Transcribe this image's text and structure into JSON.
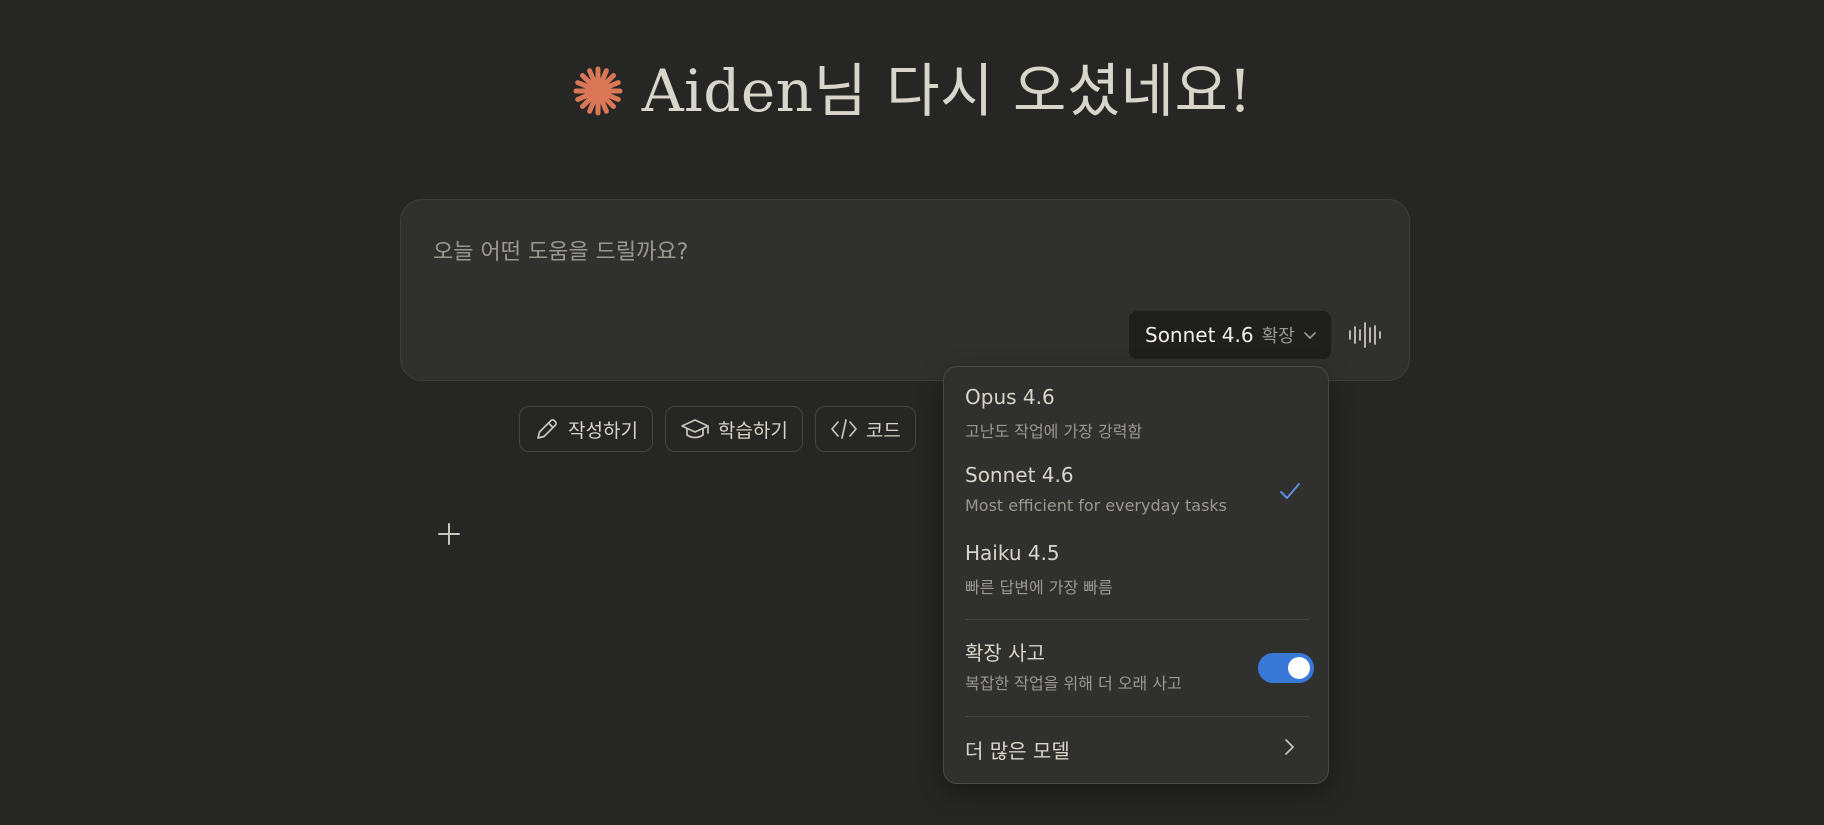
{
  "greeting": {
    "title": "Aiden님 다시 오셨네요!",
    "logo_icon": "claude-starburst-icon",
    "logo_color": "#d97757"
  },
  "composer": {
    "placeholder": "오늘 어떤 도움을 드릴까요?",
    "add_icon": "plus-icon",
    "model_name": "Sonnet 4.6",
    "model_mode": "확장",
    "model_chevron_icon": "chevron-down-icon",
    "voice_icon": "voice-waveform-icon"
  },
  "chips": [
    {
      "label": "작성하기",
      "icon": "pencil-icon"
    },
    {
      "label": "학습하기",
      "icon": "graduation-cap-icon"
    },
    {
      "label": "코드",
      "icon": "code-icon"
    }
  ],
  "model_menu": {
    "options": [
      {
        "name": "Opus 4.6",
        "description": "고난도 작업에 가장 강력함",
        "selected": false
      },
      {
        "name": "Sonnet 4.6",
        "description": "Most efficient for everyday tasks",
        "selected": true
      },
      {
        "name": "Haiku 4.5",
        "description": "빠른 답변에 가장 빠름",
        "selected": false
      }
    ],
    "extended_thinking": {
      "label": "확장 사고",
      "description": "복잡한 작업을 위해 더 오래 사고",
      "enabled": true
    },
    "more_models_label": "더 많은 모델",
    "check_icon": "checkmark-icon",
    "check_color": "#5b8fe0",
    "toggle_color": "#3a78d8",
    "more_chevron_icon": "chevron-right-icon"
  }
}
